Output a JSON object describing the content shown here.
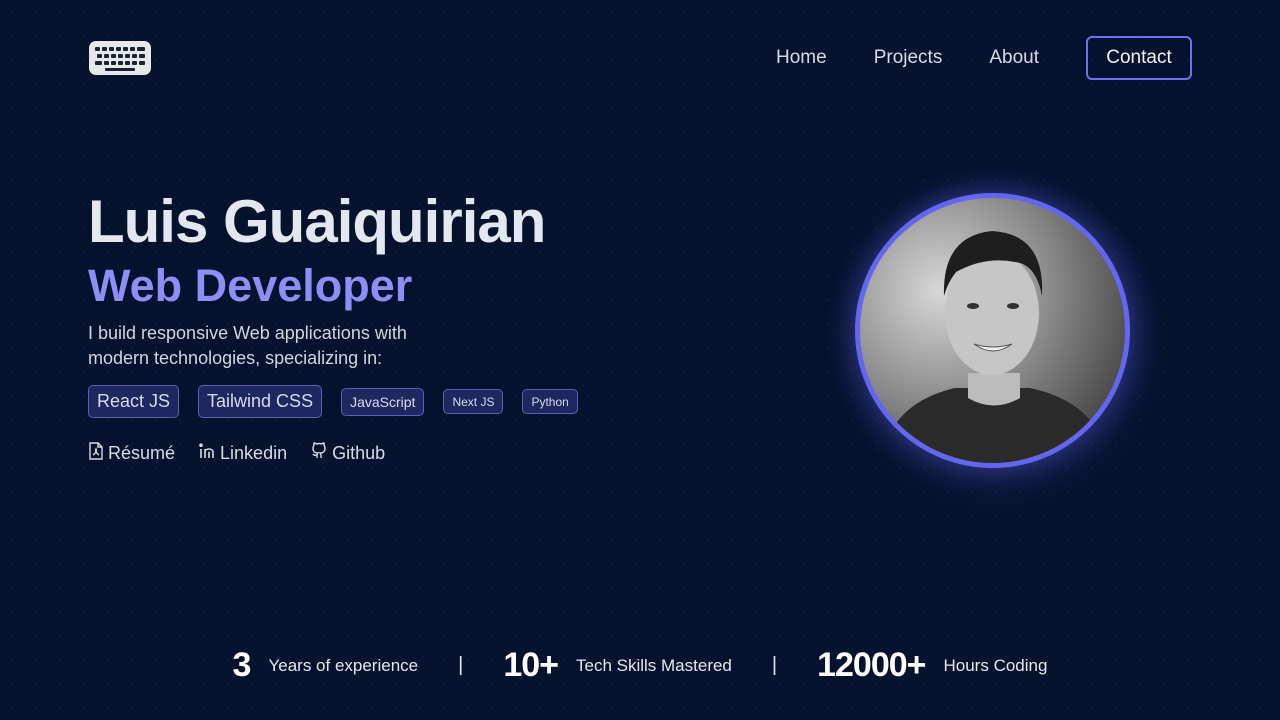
{
  "nav": {
    "logo_icon": "keyboard-icon",
    "items": [
      "Home",
      "Projects",
      "About"
    ],
    "contact_label": "Contact"
  },
  "hero": {
    "name": "Luis Guaiquirian",
    "role": "Web Developer",
    "description": "I build responsive Web applications with modern technologies, specializing in:",
    "tags": [
      "React JS",
      "Tailwind CSS",
      "JavaScript",
      "Next JS",
      "Python"
    ],
    "links": [
      {
        "label": "Résumé",
        "icon": "pdf-file-icon"
      },
      {
        "label": "Linkedin",
        "icon": "linkedin-icon"
      },
      {
        "label": "Github",
        "icon": "github-icon"
      }
    ]
  },
  "avatar": {
    "icon": "profile-photo"
  },
  "stats": [
    {
      "value": "3",
      "label": "Years of experience"
    },
    {
      "value": "10+",
      "label": "Tech Skills Mastered"
    },
    {
      "value": "12000+",
      "label": "Hours Coding"
    }
  ],
  "stats_separator": "|",
  "colors": {
    "background": "#05122e",
    "accent": "#6366f1",
    "role_text": "#8b8ff6"
  }
}
